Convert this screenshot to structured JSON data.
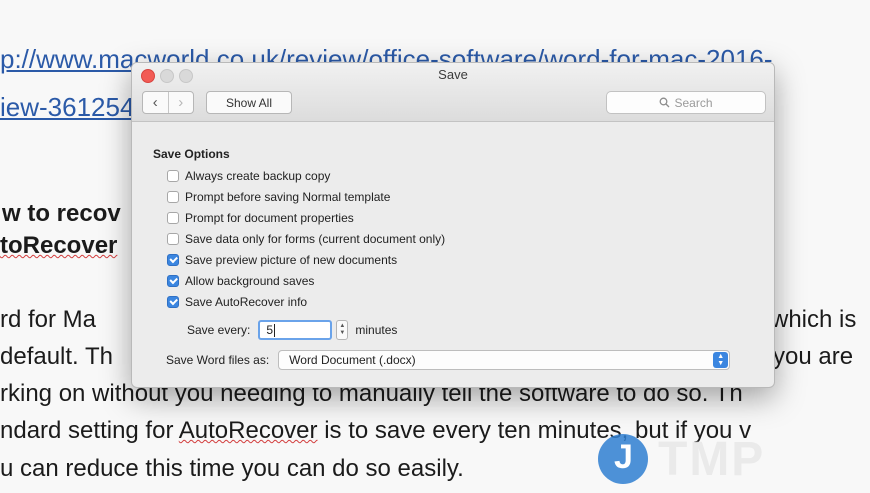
{
  "document": {
    "url_line1": "p://www.macworld.co.uk/review/office-software/word-for-mac-2016-",
    "url_line2": "iew-3612547",
    "heading_line1": "w to recov",
    "heading_line2": "toRecover",
    "body_line1_left": "rd for Ma",
    "body_line1_right": "which is",
    "body_line2_left": "default. Th",
    "body_line2_right": "you are",
    "body_line3": "rking on without you needing to manually tell the software to do so. Th",
    "body_line4_pre": "ndard setting for ",
    "body_line4_auto": "AutoRecover",
    "body_line4_post": " is to save every ten minutes, but if you v",
    "body_line5": "u can reduce this time you can do so easily."
  },
  "watermark": {
    "letter": "J",
    "text": "TMP"
  },
  "window": {
    "title": "Save",
    "show_all": "Show All",
    "search_placeholder": "Search"
  },
  "save_options": {
    "title": "Save Options",
    "options": [
      {
        "label": "Always create backup copy",
        "checked": false
      },
      {
        "label": "Prompt before saving Normal template",
        "checked": false
      },
      {
        "label": "Prompt for document properties",
        "checked": false
      },
      {
        "label": "Save data only for forms (current document only)",
        "checked": false
      },
      {
        "label": "Save preview picture of new documents",
        "checked": true
      },
      {
        "label": "Allow background saves",
        "checked": true
      },
      {
        "label": "Save AutoRecover info",
        "checked": true
      }
    ],
    "save_every_label": "Save every:",
    "save_every_value": "5",
    "minutes_label": "minutes",
    "save_as_label": "Save Word files as:",
    "save_as_value": "Word Document (.docx)"
  },
  "colors": {
    "accent": "#3b86e0",
    "link": "#2b5aa8",
    "close": "#f25b55"
  }
}
